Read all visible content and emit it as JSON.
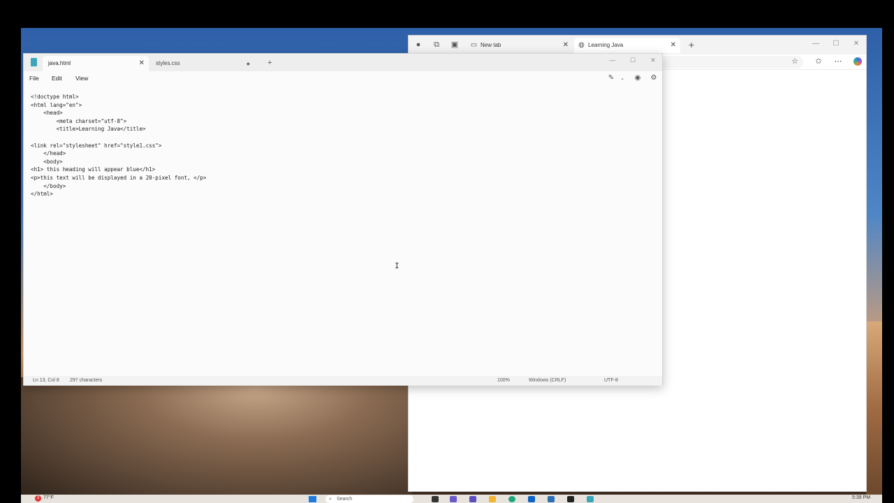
{
  "browser": {
    "tabs": [
      {
        "label": "New tab"
      },
      {
        "label": "Learning Java"
      }
    ]
  },
  "notepad": {
    "tabs": [
      {
        "label": "java.html"
      },
      {
        "label": "styles.css"
      }
    ],
    "menu": [
      "File",
      "Edit",
      "View"
    ],
    "code_lines": [
      "<!doctype html>",
      "<html lang=\"en\">",
      "    <head>",
      "        <meta charset=\"utf-8\">",
      "        <title>Learning Java</title>",
      "",
      "<link rel=\"stylesheet\" href=\"style1.css\">",
      "    </head>",
      "    <body>",
      "<h1> this heading will appear blue</h1>",
      "<p>this text will be displayed in a 20-pixel font, </p>",
      "    </body>",
      "</html>"
    ],
    "status": {
      "position": "Ln 13, Col 8",
      "characters": "297 characters",
      "zoom": "100%",
      "line_ending": "Windows (CRLF)",
      "encoding": "UTF-8"
    }
  },
  "taskbar": {
    "weather_badge": "3",
    "weather_temp": "77°F",
    "search_placeholder": "Search",
    "clock": "5:39 PM"
  },
  "icons": {
    "browser_profile": "profile-icon",
    "browser_collections": "workspaces-icon",
    "browser_tab_actions": "tab-actions-icon",
    "newtab_favicon": "page-icon",
    "learning_java_favicon": "globe-icon",
    "favorite": "star-icon",
    "favorites_list": "favorites-icon",
    "more": "ellipsis-icon",
    "copilot": "copilot-icon",
    "notepad_app": "notepad-icon",
    "copilot_tool": "magic-pen-icon",
    "account": "account-icon",
    "settings": "gear-icon"
  },
  "colors": {
    "accent": "#1f7be0",
    "notepad_bg": "#fbfbfb",
    "taskbar_bg": "#e8e3dd"
  }
}
